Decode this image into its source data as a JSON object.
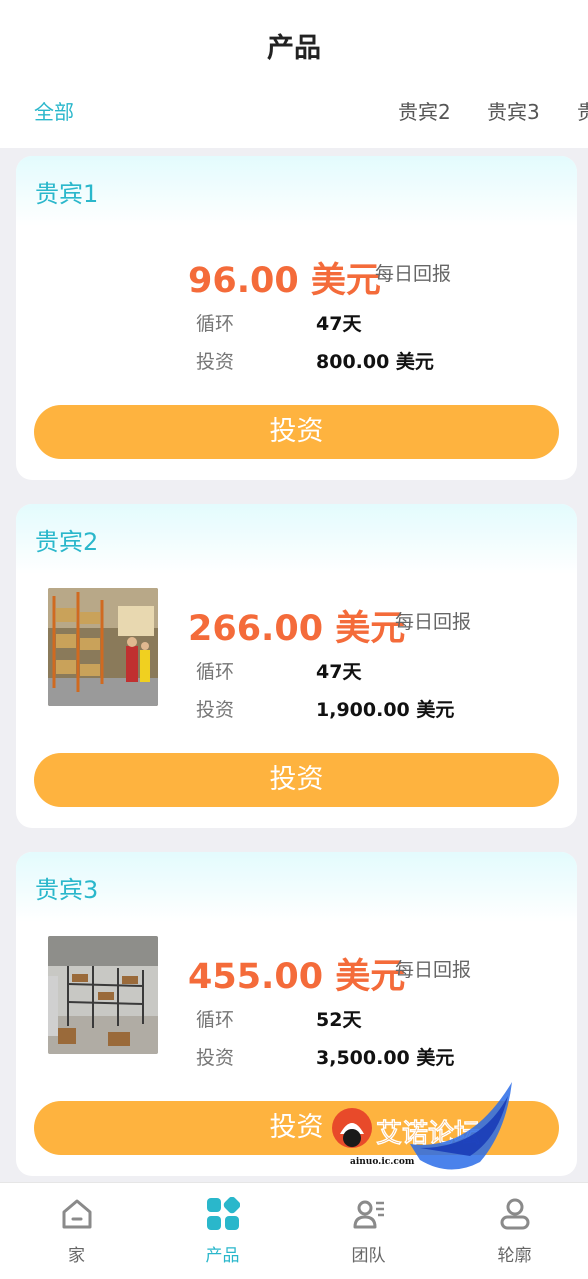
{
  "header": {
    "title": "产品"
  },
  "tabs": [
    {
      "label": "全部",
      "active": true
    },
    {
      "label": "贵宾2"
    },
    {
      "label": "贵宾3"
    },
    {
      "label": "贵"
    }
  ],
  "products": [
    {
      "name": "贵宾1",
      "price": "96.00 美元",
      "daily_label": "每日回报",
      "cycle_label": "循环",
      "cycle_value": "47天",
      "invest_label": "投资",
      "invest_value": "800.00 美元",
      "button_label": "投资",
      "image": "none"
    },
    {
      "name": "贵宾2",
      "price": "266.00 美元",
      "daily_label": "每日回报",
      "cycle_label": "循环",
      "cycle_value": "47天",
      "invest_label": "投资",
      "invest_value": "1,900.00 美元",
      "button_label": "投资",
      "image": "warehouse-photo"
    },
    {
      "name": "贵宾3",
      "price": "455.00 美元",
      "daily_label": "每日回报",
      "cycle_label": "循环",
      "cycle_value": "52天",
      "invest_label": "投资",
      "invest_value": "3,500.00 美元",
      "button_label": "投资",
      "image": "warehouse-photo"
    }
  ],
  "watermark": {
    "text": "艾诺论坛",
    "subtext": "ainuo.ic.com"
  },
  "nav": [
    {
      "label": "家",
      "icon": "home-icon"
    },
    {
      "label": "产品",
      "icon": "grid-icon",
      "active": true
    },
    {
      "label": "团队",
      "icon": "team-icon"
    },
    {
      "label": "轮廓",
      "icon": "profile-icon"
    }
  ],
  "colors": {
    "accent": "#2ab7cb",
    "price": "#f46b3a",
    "button": "#feb33f",
    "background": "#efeff3"
  }
}
